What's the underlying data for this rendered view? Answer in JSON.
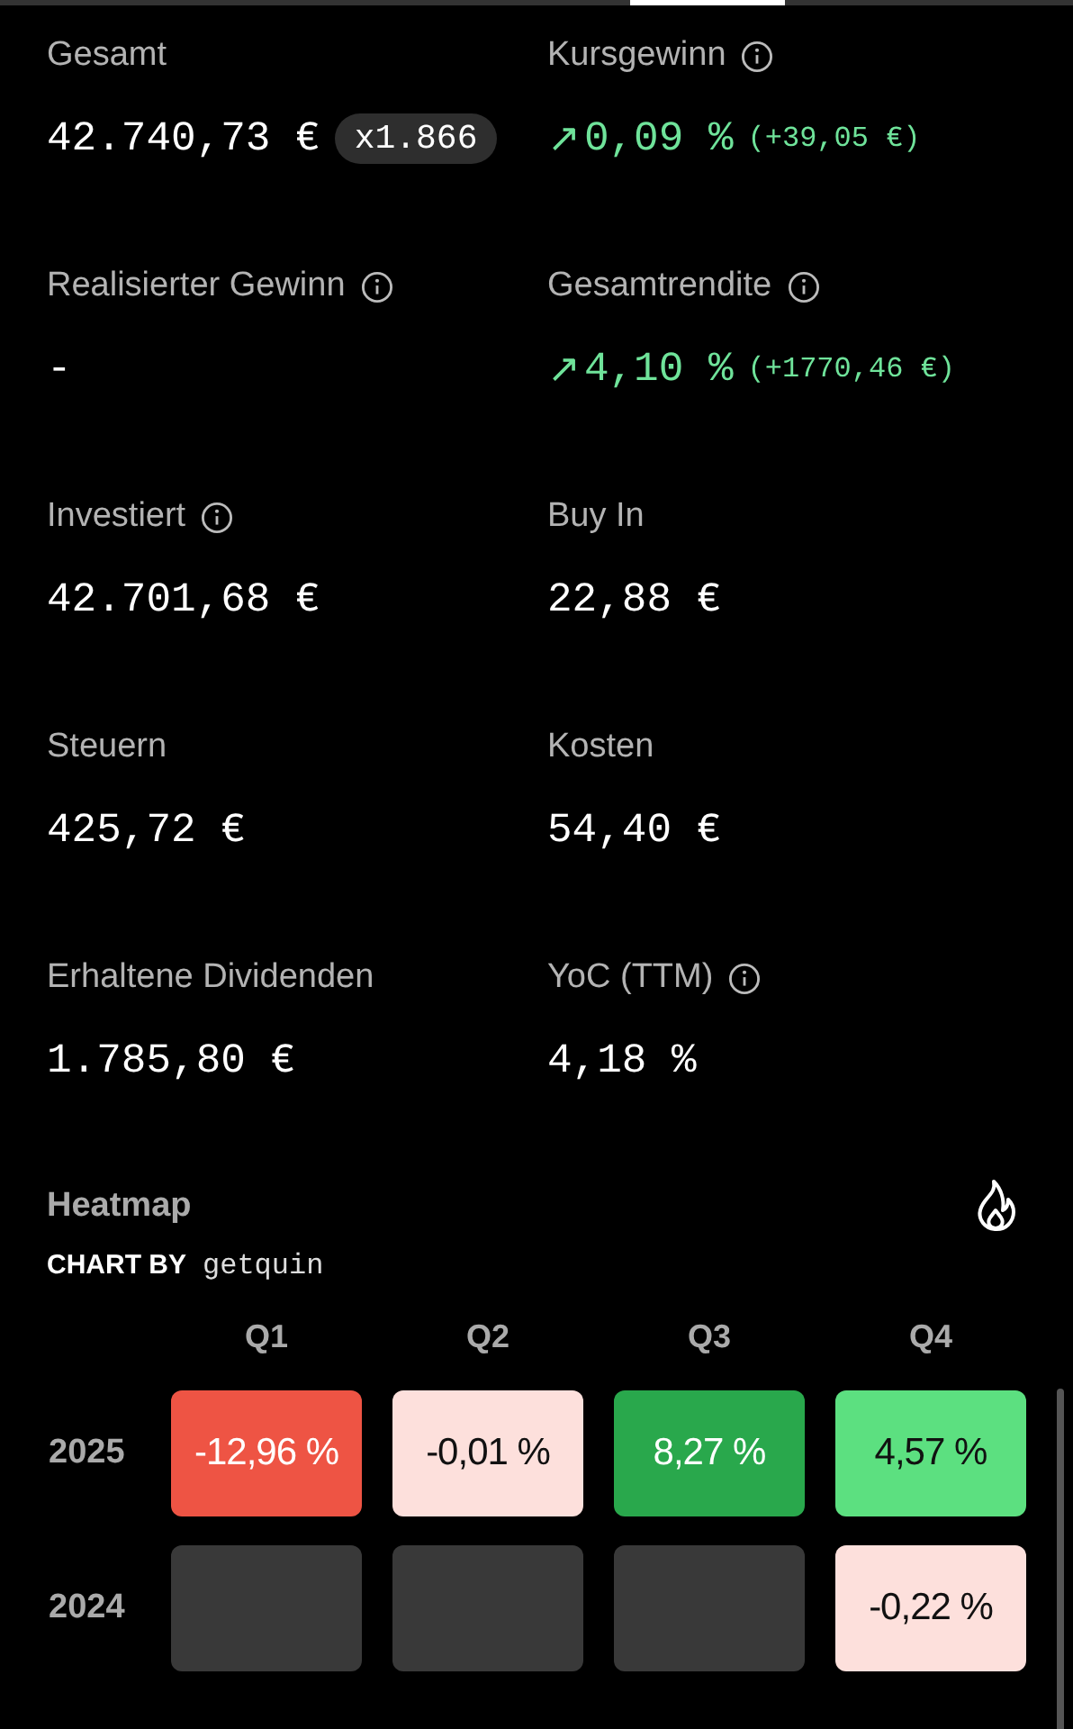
{
  "metrics": [
    {
      "kind": "badge",
      "label": "Gesamt",
      "info": false,
      "value": "42.740,73 €",
      "badge": "x1.866"
    },
    {
      "kind": "gain",
      "label": "Kursgewinn",
      "info": true,
      "arrow": "↗",
      "value": "0,09 %",
      "detail": "(+39,05 €)"
    },
    {
      "kind": "plain",
      "label": "Realisierter Gewinn",
      "info": true,
      "value": "-"
    },
    {
      "kind": "gain",
      "label": "Gesamtrendite",
      "info": true,
      "arrow": "↗",
      "value": "4,10 %",
      "detail": "(+1770,46 €)"
    },
    {
      "kind": "plain",
      "label": "Investiert",
      "info": true,
      "value": "42.701,68 €"
    },
    {
      "kind": "plain",
      "label": "Buy In",
      "info": false,
      "value": "22,88 €"
    },
    {
      "kind": "plain",
      "label": "Steuern",
      "info": false,
      "value": "425,72 €"
    },
    {
      "kind": "plain",
      "label": "Kosten",
      "info": false,
      "value": "54,40 €"
    },
    {
      "kind": "plain",
      "label": "Erhaltene Dividenden",
      "info": false,
      "value": "1.785,80 €"
    },
    {
      "kind": "plain",
      "label": "YoC (TTM)",
      "info": true,
      "value": "4,18 %"
    }
  ],
  "heatmap": {
    "title": "Heatmap",
    "credit_label": "CHART BY",
    "credit_brand": "getquin",
    "columns": [
      "Q1",
      "Q2",
      "Q3",
      "Q4"
    ],
    "rows": [
      {
        "year": "2025",
        "cells": [
          {
            "value": "-12,96 %",
            "color": "#ee5444"
          },
          {
            "value": "-0,01 %",
            "color": "#fde0dc"
          },
          {
            "value": "8,27 %",
            "color": "#29a84c"
          },
          {
            "value": "4,57 %",
            "color": "#5ce080"
          }
        ]
      },
      {
        "year": "2024",
        "cells": [
          {
            "color": "#393939"
          },
          {
            "color": "#393939"
          },
          {
            "color": "#393939"
          },
          {
            "value": "-0,22 %",
            "color": "#fde0dc"
          }
        ]
      }
    ]
  }
}
